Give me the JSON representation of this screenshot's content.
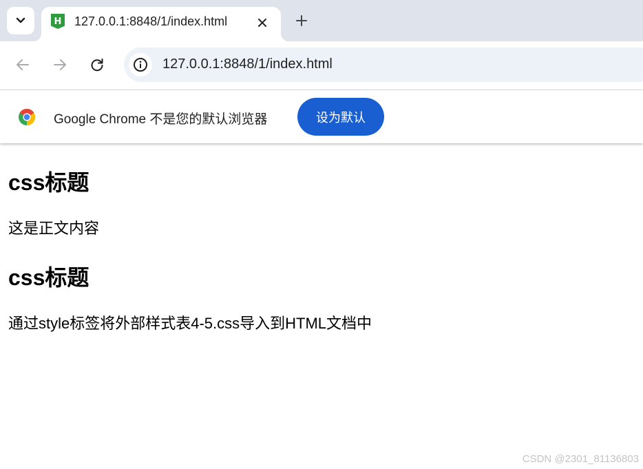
{
  "browser": {
    "tab": {
      "title": "127.0.0.1:8848/1/index.html",
      "favicon_letter": "H"
    },
    "omnibox": {
      "url": "127.0.0.1:8848/1/index.html"
    },
    "icons": {
      "tab_search": "chevron-down-icon",
      "close": "close-icon",
      "new_tab": "plus-icon",
      "back": "back-arrow-icon",
      "forward": "forward-arrow-icon",
      "reload": "reload-icon",
      "site_info": "info-icon",
      "chrome": "chrome-logo-icon"
    }
  },
  "infobar": {
    "message": "Google Chrome 不是您的默认浏览器",
    "button_label": "设为默认"
  },
  "page": {
    "heading1": "css标题",
    "paragraph1": "这是正文内容",
    "heading2": "css标题",
    "paragraph2": "通过style标签将外部样式表4-5.css导入到HTML文档中"
  },
  "watermark": "CSDN @2301_81136803",
  "colors": {
    "tabstrip_bg": "#dfe3eb",
    "omnibox_bg": "#edf1f8",
    "primary_button": "#1a5fd1",
    "favicon": "#2e9b3f"
  }
}
